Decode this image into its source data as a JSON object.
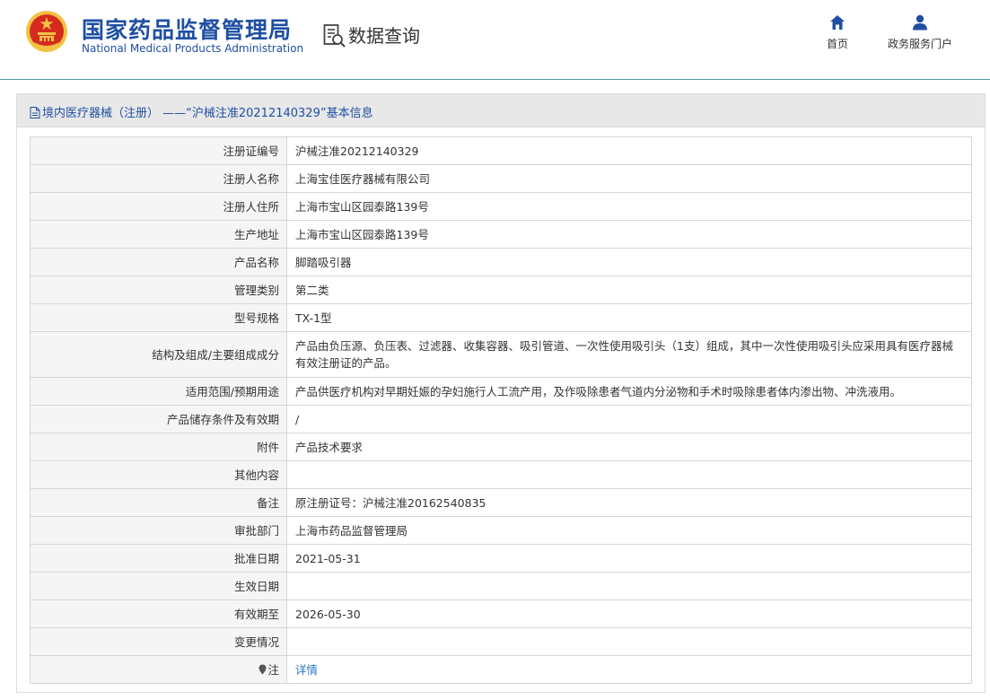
{
  "header": {
    "logo_cn": "国家药品监督管理局",
    "logo_en": "National Medical Products Administration",
    "section": "数据查询",
    "nav": [
      {
        "label": "首页",
        "icon": "home-icon"
      },
      {
        "label": "政务服务门户",
        "icon": "user-icon"
      }
    ]
  },
  "colors": {
    "brand": "#1f4fa3",
    "link": "#2b78c5",
    "divider": "#4c98a3",
    "emblem": "#d52b1e"
  },
  "panel": {
    "title": "境内医疗器械（注册） ——“沪械注准20212140329”基本信息"
  },
  "rows": [
    {
      "label": "注册证编号",
      "value": "沪械注准20212140329"
    },
    {
      "label": "注册人名称",
      "value": "上海宝佳医疗器械有限公司"
    },
    {
      "label": "注册人住所",
      "value": "上海市宝山区园泰路139号"
    },
    {
      "label": "生产地址",
      "value": "上海市宝山区园泰路139号"
    },
    {
      "label": "产品名称",
      "value": "脚踏吸引器"
    },
    {
      "label": "管理类别",
      "value": "第二类"
    },
    {
      "label": "型号规格",
      "value": "TX-1型"
    },
    {
      "label": "结构及组成/主要组成成分",
      "value": "产品由负压源、负压表、过滤器、收集容器、吸引管道、一次性使用吸引头（1支）组成，其中一次性使用吸引头应采用具有医疗器械有效注册证的产品。"
    },
    {
      "label": "适用范围/预期用途",
      "value": "产品供医疗机构对早期妊娠的孕妇施行人工流产用，及作吸除患者气道内分泌物和手术时吸除患者体内渗出物、冲洗液用。"
    },
    {
      "label": "产品储存条件及有效期",
      "value": "/"
    },
    {
      "label": "附件",
      "value": "产品技术要求"
    },
    {
      "label": "其他内容",
      "value": ""
    },
    {
      "label": "备注",
      "value": "原注册证号：沪械注准20162540835"
    },
    {
      "label": "审批部门",
      "value": "上海市药品监督管理局"
    },
    {
      "label": "批准日期",
      "value": "2021-05-31"
    },
    {
      "label": "生效日期",
      "value": ""
    },
    {
      "label": "有效期至",
      "value": "2026-05-30"
    },
    {
      "label": "变更情况",
      "value": ""
    },
    {
      "label": "注",
      "value": "详情",
      "icon": "pin-icon"
    }
  ]
}
